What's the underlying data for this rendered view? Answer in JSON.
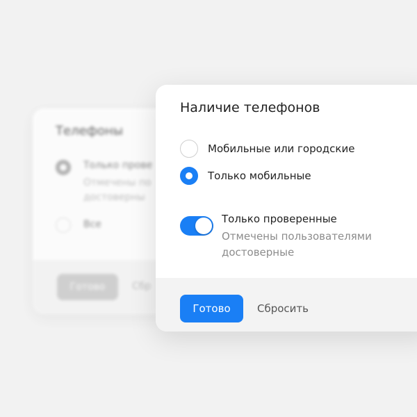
{
  "back_panel": {
    "title": "Телефоны",
    "option_checked_label": "Только прове",
    "option_checked_sub_1": "Отмечены по",
    "option_checked_sub_2": "достоверны",
    "option_unchecked_label": "Все",
    "done_label": "Готово",
    "reset_label": "Сбр"
  },
  "front_panel": {
    "title": "Наличие телефонов",
    "options": [
      {
        "label": "Мобильные или городские",
        "selected": false
      },
      {
        "label": "Только мобильные",
        "selected": true
      }
    ],
    "toggle": {
      "label": "Только проверенные",
      "description_line_1": "Отмечены пользователями",
      "description_line_2": "достоверные",
      "enabled": true
    },
    "done_label": "Готово",
    "reset_label": "Сбросить"
  },
  "colors": {
    "accent": "#1a7ff5",
    "background": "#f2f2f2",
    "footer": "#f3f3f3",
    "secondary_text": "#8c8c8c"
  }
}
